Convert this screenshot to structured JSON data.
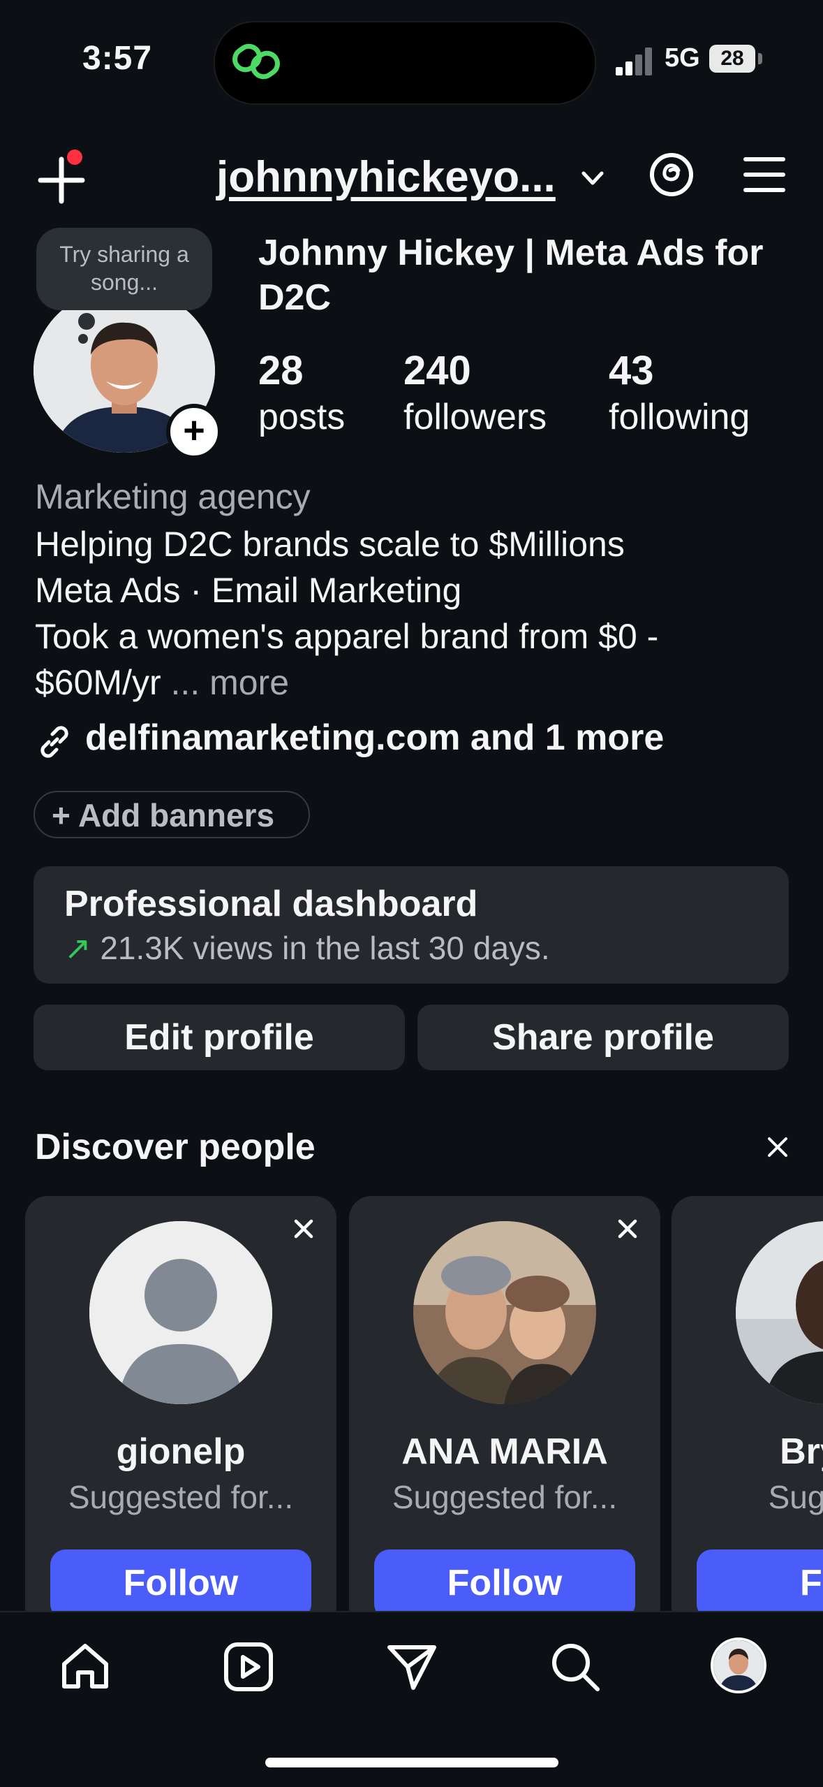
{
  "status_bar": {
    "time": "3:57",
    "network": "5G",
    "battery": "28"
  },
  "header": {
    "username": "johnnyhickeyo...",
    "new_post_badge": true
  },
  "profile": {
    "note": "Try sharing a song...",
    "display_name": "Johnny Hickey | Meta Ads for D2C",
    "stats": [
      {
        "value": "28",
        "label": "posts"
      },
      {
        "value": "240",
        "label": "followers"
      },
      {
        "value": "43",
        "label": "following"
      }
    ],
    "category": "Marketing agency",
    "bio_lines": [
      "Helping D2C brands scale to $Millions",
      "Meta Ads · Email Marketing",
      "Took a women's apparel brand from $0 -",
      "$60M/yr"
    ],
    "bio_more": "... more",
    "link": "delfinamarketing.com and 1 more",
    "add_banners": "Add banners"
  },
  "dashboard": {
    "title": "Professional dashboard",
    "subtitle": "21.3K views in the last 30 days."
  },
  "actions": {
    "edit": "Edit profile",
    "share": "Share profile"
  },
  "discover": {
    "title": "Discover people",
    "cards": [
      {
        "name": "gionelp",
        "subtitle": "Suggested for...",
        "button": "Follow"
      },
      {
        "name": "ANA MARIA",
        "subtitle": "Suggested for...",
        "button": "Follow"
      },
      {
        "name": "Bryar",
        "subtitle": "Suggest",
        "button": "Fol"
      }
    ]
  },
  "tabbar": {
    "items": [
      "home-icon",
      "reels-icon",
      "send-icon",
      "search-icon",
      "profile-avatar"
    ]
  },
  "colors": {
    "background": "#0c1014",
    "accent": "#4a5df9",
    "surface": "#25292e",
    "badge": "#ff3040"
  }
}
